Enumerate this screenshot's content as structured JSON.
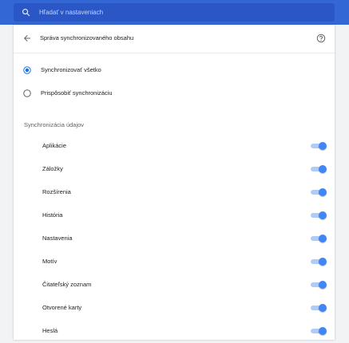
{
  "search": {
    "placeholder": "Hľadať v nastaveniach",
    "icon": "search-icon"
  },
  "header": {
    "title": "Správa synchronizovaného obsahu",
    "back_icon": "arrow-back-icon",
    "help_icon": "help-icon"
  },
  "sync_mode": {
    "options": [
      {
        "label": "Synchronizovať všetko",
        "selected": true
      },
      {
        "label": "Prispôsobiť synchronizáciu",
        "selected": false
      }
    ]
  },
  "data_section": {
    "title": "Synchronizácia údajov",
    "items": [
      {
        "label": "Aplikácie",
        "enabled": true
      },
      {
        "label": "Záložky",
        "enabled": true
      },
      {
        "label": "Rozšírenia",
        "enabled": true
      },
      {
        "label": "História",
        "enabled": true
      },
      {
        "label": "Nastavenia",
        "enabled": true
      },
      {
        "label": "Motív",
        "enabled": true
      },
      {
        "label": "Čitateľský zoznam",
        "enabled": true
      },
      {
        "label": "Otvorené karty",
        "enabled": true
      },
      {
        "label": "Heslá",
        "enabled": true
      }
    ]
  },
  "colors": {
    "accent": "#1a73e8",
    "toolbar": "#3367d6",
    "toggle_on": "#4285f4"
  }
}
